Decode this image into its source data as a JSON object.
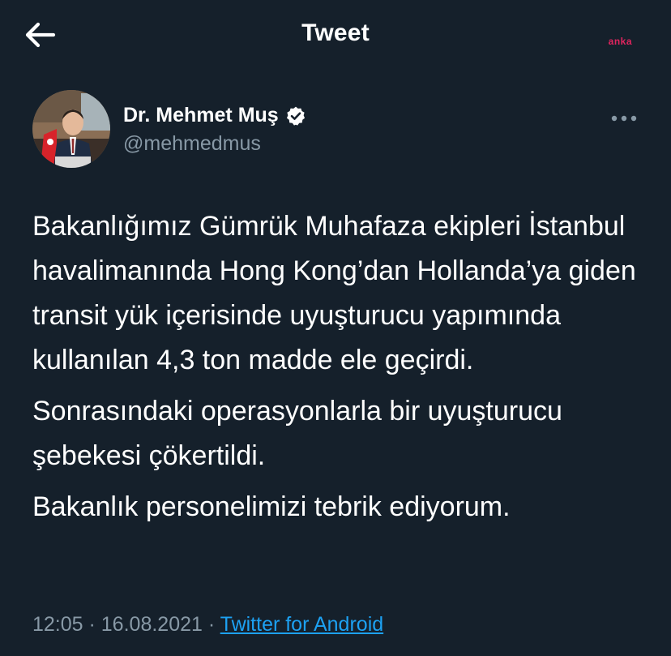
{
  "header": {
    "title": "Tweet",
    "watermark": "anka",
    "back_icon": "arrow-left-icon"
  },
  "author": {
    "name": "Dr. Mehmet Muş",
    "handle": "@mehmedmus",
    "verified_icon": "verified-badge-icon",
    "more_icon": "more-horizontal-icon"
  },
  "tweet": {
    "paragraphs": [
      "Bakanlığımız Gümrük Muhafaza ekipleri İstanbul havalimanında Hong Kong’dan Hollanda’ya giden transit yük içerisinde uyuşturucu yapımında kullanılan 4,3 ton madde ele geçirdi.",
      "Sonrasındaki operasyonlarla bir uyuşturucu şebekesi çökertildi.",
      "Bakanlık personelimizi tebrik ediyorum."
    ]
  },
  "meta": {
    "time": "12:05",
    "date": "16.08.2021",
    "separator": " · ",
    "source": "Twitter for Android"
  },
  "colors": {
    "background": "#15202b",
    "text": "#ffffff",
    "secondary": "#8899a6",
    "accent": "#1da1f2",
    "watermark": "#e0245e"
  }
}
